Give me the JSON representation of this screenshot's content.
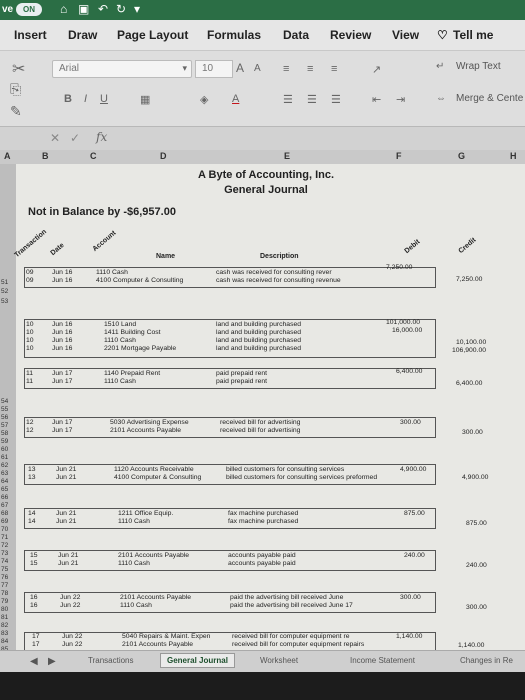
{
  "titlebar": {
    "autosave": "ve",
    "toggle": "ON"
  },
  "menu": {
    "tabs": [
      "Insert",
      "Draw",
      "Page Layout",
      "Formulas",
      "Data",
      "Review",
      "View",
      "Tell me"
    ]
  },
  "ribbon": {
    "font_name": "Arial",
    "font_size": "10",
    "wrap_text": "Wrap Text",
    "merge": "Merge & Cente"
  },
  "formula": {
    "fx": "fx",
    "content": ""
  },
  "columns": [
    "A",
    "B",
    "C",
    "D",
    "E",
    "F",
    "G",
    "H"
  ],
  "rows": [
    "51",
    "52",
    "53",
    "54",
    "55",
    "56",
    "57",
    "58",
    "59",
    "60",
    "61",
    "62",
    "63",
    "64",
    "65",
    "66",
    "67",
    "68",
    "69",
    "70",
    "71",
    "72",
    "73",
    "74",
    "75",
    "76",
    "77",
    "78",
    "79",
    "80",
    "81",
    "82",
    "83",
    "84",
    "85",
    "86",
    "87"
  ],
  "sheet": {
    "title": "A Byte of Accounting, Inc.",
    "subtitle": "General Journal",
    "balance_note": "Not in Balance by -$6,957.00",
    "headers": {
      "transaction": "Transaction",
      "date": "Date",
      "account": "Account",
      "name": "Name",
      "description": "Description",
      "debit": "Debit",
      "credit": "Credit"
    },
    "entries": [
      {
        "tx": [
          "09",
          "09"
        ],
        "date": [
          "Jun 16",
          "Jun 16"
        ],
        "acct": [
          "1110 Cash",
          "4100 Computer & Consulting"
        ],
        "desc": [
          "cash was received for consulting rever",
          "cash was received for consulting revenue"
        ],
        "debit": [
          "7,250.00"
        ],
        "credit": [
          "7,250.00"
        ]
      },
      {
        "tx": [
          "10",
          "10",
          "10",
          "10"
        ],
        "date": [
          "Jun 16",
          "Jun 16",
          "Jun 16",
          "Jun 16"
        ],
        "acct": [
          "1510 Land",
          "1411 Building Cost",
          "1110 Cash",
          "2201 Mortgage Payable"
        ],
        "desc": [
          "land and building purchased",
          "land and building purchased",
          "land and building purchased",
          "land and building purchased"
        ],
        "debit": [
          "101,000.00",
          "16,000.00"
        ],
        "credit": [
          "10,100.00",
          "106,900.00"
        ]
      },
      {
        "tx": [
          "11",
          "11"
        ],
        "date": [
          "Jun 17",
          "Jun 17"
        ],
        "acct": [
          "1140 Prepaid Rent",
          "1110 Cash"
        ],
        "desc": [
          "paid prepaid rent",
          "paid prepaid rent"
        ],
        "debit": [
          "6,400.00"
        ],
        "credit": [
          "6,400.00"
        ]
      },
      {
        "tx": [
          "12",
          "12"
        ],
        "date": [
          "Jun 17",
          "Jun 17"
        ],
        "acct": [
          "5030 Advertising Expense",
          "2101 Accounts Payable"
        ],
        "desc": [
          "received bill for advertising",
          "received bill for advertising"
        ],
        "debit": [
          "300.00"
        ],
        "credit": [
          "300.00"
        ]
      },
      {
        "tx": [
          "13",
          "13"
        ],
        "date": [
          "Jun 21",
          "Jun 21"
        ],
        "acct": [
          "1120 Accounts Receivable",
          "4100 Computer & Consulting"
        ],
        "desc": [
          "billed customers for consulting services",
          "billed customers for consulting services preformed"
        ],
        "debit": [
          "4,900.00"
        ],
        "credit": [
          "4,900.00"
        ]
      },
      {
        "tx": [
          "14",
          "14"
        ],
        "date": [
          "Jun 21",
          "Jun 21"
        ],
        "acct": [
          "1211 Office Equip.",
          "1110 Cash"
        ],
        "desc": [
          "fax machine purchased",
          "fax machine purchased"
        ],
        "debit": [
          "875.00"
        ],
        "credit": [
          "875.00"
        ]
      },
      {
        "tx": [
          "15",
          "15"
        ],
        "date": [
          "Jun 21",
          "Jun 21"
        ],
        "acct": [
          "2101 Accounts Payable",
          "1110 Cash"
        ],
        "desc": [
          "accounts payable paid",
          "accounts payable paid"
        ],
        "debit": [
          "240.00"
        ],
        "credit": [
          "240.00"
        ]
      },
      {
        "tx": [
          "16",
          "16"
        ],
        "date": [
          "Jun 22",
          "Jun 22"
        ],
        "acct": [
          "2101 Accounts Payable",
          "1110 Cash"
        ],
        "desc": [
          "paid the advertising bill received June",
          "paid the advertising bill received June 17"
        ],
        "debit": [
          "300.00"
        ],
        "credit": [
          "300.00"
        ]
      },
      {
        "tx": [
          "17",
          "17"
        ],
        "date": [
          "Jun 22",
          "Jun 22"
        ],
        "acct": [
          "5040 Repairs & Maint. Expen",
          "2101 Accounts Payable"
        ],
        "desc": [
          "received bill for computer equipment re",
          "received bill for computer equipment repairs"
        ],
        "debit": [
          "1,140.00"
        ],
        "credit": [
          "1,140.00"
        ]
      }
    ]
  },
  "sheet_tabs": [
    "Transactions",
    "General Journal",
    "Worksheet",
    "Income Statement",
    "Changes in Re"
  ],
  "colors": {
    "accent": "#2b6e45",
    "alert": "#c4161c"
  }
}
